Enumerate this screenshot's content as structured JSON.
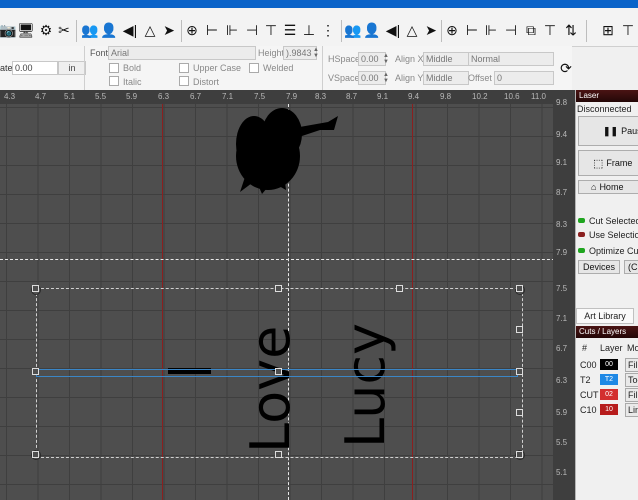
{
  "colors": {
    "titlebar": "#0a63c9",
    "canvas": "#4e4e4e",
    "panel_header": "#3a0f0f",
    "layer_00": "#000000",
    "layer_T2": "#1e88e5",
    "layer_02": "#d32f2f",
    "layer_10": "#b71c1c",
    "led_green": "#1fa51f",
    "led_red": "#8a1f1f"
  },
  "toolbar": {
    "icons": [
      "camera-icon",
      "monitor-icon",
      "gear-wrench-icon",
      "tools-icon",
      "users-icon",
      "user-icon",
      "mirror-h-icon",
      "mirror-v-icon",
      "send-icon",
      "crosshair-target-icon",
      "align-left-icon",
      "align-center-h-icon",
      "align-right-icon",
      "align-top-icon",
      "align-middle-v-icon",
      "align-bottom-icon",
      "distribute-icon",
      "mirror-h-icon",
      "user-icon",
      "mirror-v-icon",
      "send-icon",
      "crosshair-target-icon",
      "align-left-icon",
      "align-center-icon",
      "align-right-icon",
      "group-icon",
      "align-top-icon",
      "split-icon",
      "align-grid-icon"
    ]
  },
  "options": {
    "rotate_label": "ate",
    "rotate_value": "0.00",
    "unit_button": "in",
    "font_label": "Font",
    "font_value": "Arial",
    "height_label": "Height",
    "height_value": ").9843",
    "bold": "Bold",
    "italic": "Italic",
    "upper_case": "Upper Case",
    "distort": "Distort",
    "welded": "Welded",
    "hspace_label": "HSpace",
    "hspace_value": "0.00",
    "vspace_label": "VSpace",
    "vspace_value": "0.00",
    "alignx_label": "Align X",
    "alignx_value": "Middle",
    "aligny_label": "Align Y",
    "aligny_value": "Middle",
    "normal_value": "Normal",
    "offset_label": "Offset",
    "offset_value": "0"
  },
  "ruler": {
    "ticks": [
      "4.3",
      "4.7",
      "5.1",
      "5.5",
      "5.9",
      "6.3",
      "6.7",
      "7.1",
      "7.5",
      "7.9",
      "8.3",
      "8.7",
      "9.1",
      "9.4",
      "9.8",
      "10.2",
      "10.6",
      "11.0"
    ]
  },
  "vruler": {
    "ticks": [
      "9.8",
      "9.4",
      "9.1",
      "8.7",
      "8.3",
      "7.9",
      "7.5",
      "7.1",
      "6.7",
      "6.3",
      "5.9",
      "5.5",
      "5.1"
    ]
  },
  "canvas": {
    "text_i": "I",
    "text_love": "Love",
    "text_lucy": "Lucy"
  },
  "laser": {
    "header": "Laser",
    "status": "Disconnected",
    "pause": "Pause",
    "frame": "Frame",
    "home": "Home",
    "cut_selected": "Cut Selected",
    "use_selection": "Use Selection",
    "optimize_cut": "Optimize Cut",
    "devices": "Devices",
    "devices_extra": "(Cl"
  },
  "art_library": "Art Library",
  "cuts_layers": {
    "header": "Cuts / Layers",
    "columns": [
      "#",
      "Layer",
      "Mo"
    ],
    "rows": [
      {
        "id": "C00",
        "chip": "00",
        "mode": "Fill"
      },
      {
        "id": "T2",
        "chip": "T2",
        "mode": "Too"
      },
      {
        "id": "CUT",
        "chip": "02",
        "mode": "Fill"
      },
      {
        "id": "C10",
        "chip": "10",
        "mode": "Lin"
      }
    ]
  }
}
